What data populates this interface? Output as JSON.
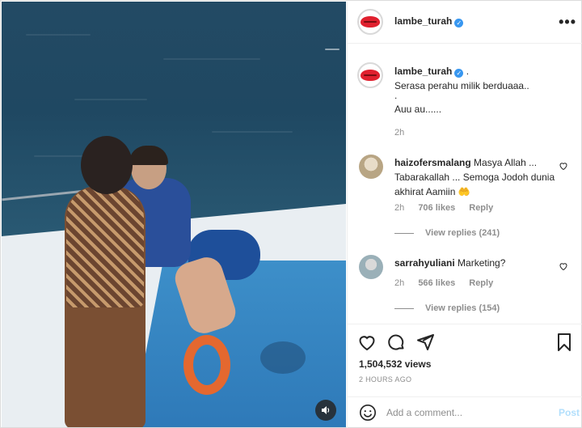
{
  "post": {
    "username": "lambe_turah",
    "more_label": "•••"
  },
  "caption": {
    "username": "lambe_turah",
    "suffix": ".",
    "lines": [
      "Serasa perahu milik berduaaa..",
      ".",
      "Auu au......"
    ],
    "time": "2h"
  },
  "comments": [
    {
      "username": "haizofersmalang",
      "text": "Masya Allah ... Tabarakallah ... Semoga Jodoh dunia akhirat Aamiin 🤲",
      "time": "2h",
      "likes": "706 likes",
      "reply_label": "Reply",
      "view_replies": "View replies (241)"
    },
    {
      "username": "sarrahyuliani",
      "text": "Marketing?",
      "time": "2h",
      "likes": "566 likes",
      "reply_label": "Reply",
      "view_replies": "View replies (154)"
    }
  ],
  "stats": {
    "views": "1,504,532 views",
    "posted": "2 HOURS AGO"
  },
  "add_comment": {
    "placeholder": "Add a comment...",
    "post_label": "Post"
  },
  "colors": {
    "accent": "#3897f0",
    "post_disabled": "#b2dffc",
    "brand_red": "#e0202e"
  },
  "icons": [
    "mute-icon",
    "heart-icon",
    "comment-icon",
    "share-icon",
    "bookmark-icon",
    "emoji-icon",
    "verified-icon",
    "more-icon"
  ]
}
